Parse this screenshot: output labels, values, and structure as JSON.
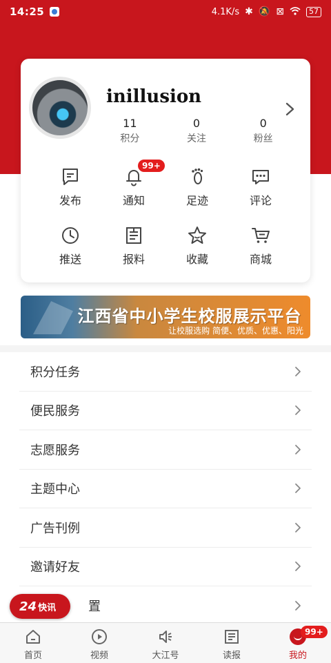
{
  "status_bar": {
    "time": "14:25",
    "network_speed": "4.1K/s",
    "battery": "57"
  },
  "profile": {
    "username": "inillusion",
    "stats": [
      {
        "value": "11",
        "label": "积分"
      },
      {
        "value": "0",
        "label": "关注"
      },
      {
        "value": "0",
        "label": "粉丝"
      }
    ]
  },
  "actions": {
    "publish": "发布",
    "notify": "通知",
    "notify_badge": "99+",
    "footprint": "足迹",
    "comment": "评论",
    "push": "推送",
    "report": "报料",
    "favorite": "收藏",
    "mall": "商城"
  },
  "banner": {
    "title": "江西省中小学生校服展示平台",
    "subtitle": "让校服选购 简便、优质、优惠、阳光"
  },
  "menu": {
    "items": [
      {
        "label": "积分任务"
      },
      {
        "label": "便民服务"
      },
      {
        "label": "志愿服务"
      },
      {
        "label": "主题中心"
      },
      {
        "label": "广告刊例"
      },
      {
        "label": "邀请好友"
      },
      {
        "label": "置"
      }
    ]
  },
  "flash": {
    "number": "24",
    "text": "快讯"
  },
  "tabs": {
    "home": "首页",
    "video": "视频",
    "dajiang": "大江号",
    "reading": "读报",
    "mine": "我的",
    "mine_badge": "99+"
  },
  "colors": {
    "brand_red": "#c8161d",
    "badge_red": "#e31d1d"
  }
}
